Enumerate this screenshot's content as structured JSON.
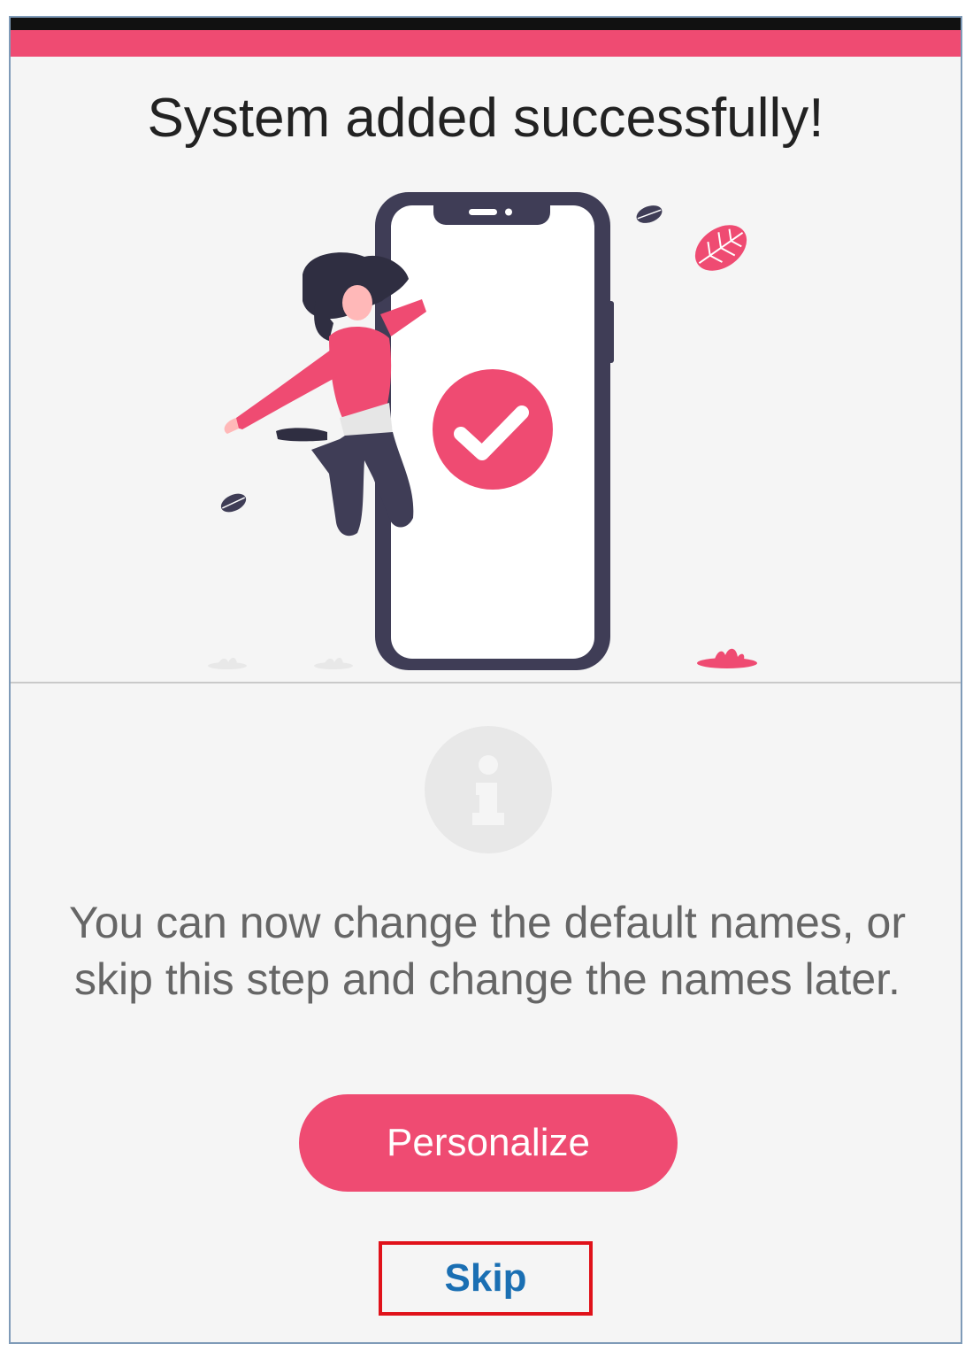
{
  "colors": {
    "accent": "#ef4b72",
    "link": "#1a6fb3",
    "dark": "#3f3d56"
  },
  "title": "System added successfully!",
  "illustration": {
    "name": "woman-jumping-with-phone-checkmark-illustration"
  },
  "info": {
    "icon": "info-icon",
    "message": "You can now change the default names, or skip this step and change the names later."
  },
  "actions": {
    "personalize_label": "Personalize",
    "skip_label": "Skip"
  }
}
